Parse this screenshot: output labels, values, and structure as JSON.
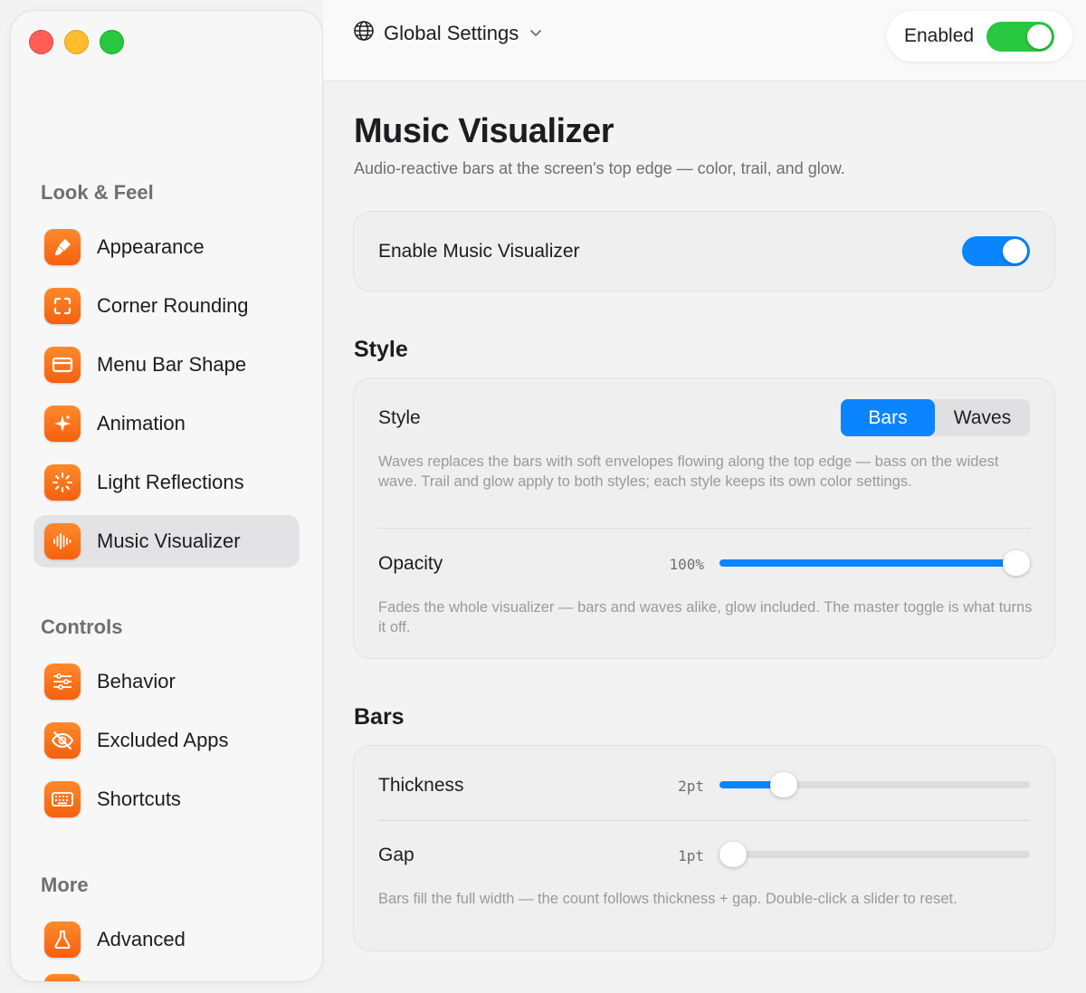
{
  "sidebar": {
    "sections": [
      {
        "title": "Look & Feel"
      },
      {
        "title": "Controls"
      },
      {
        "title": "More"
      }
    ],
    "items": [
      {
        "label": "Appearance",
        "icon": "paintbrush-icon"
      },
      {
        "label": "Corner Rounding",
        "icon": "corners-icon"
      },
      {
        "label": "Menu Bar Shape",
        "icon": "window-icon"
      },
      {
        "label": "Animation",
        "icon": "sparkle-icon"
      },
      {
        "label": "Light Reflections",
        "icon": "sun-rays-icon"
      },
      {
        "label": "Music Visualizer",
        "icon": "waveform-icon",
        "selected": true
      },
      {
        "label": "Behavior",
        "icon": "sliders-icon"
      },
      {
        "label": "Excluded Apps",
        "icon": "eye-slash-icon"
      },
      {
        "label": "Shortcuts",
        "icon": "keyboard-icon"
      },
      {
        "label": "Advanced",
        "icon": "flask-icon"
      }
    ]
  },
  "header": {
    "scope_label": "Global Settings",
    "enabled_label": "Enabled",
    "enabled": true
  },
  "page": {
    "title": "Music Visualizer",
    "subtitle": "Audio-reactive bars at the screen's top edge — color, trail, and glow."
  },
  "enable_card": {
    "label": "Enable Music Visualizer",
    "on": true
  },
  "style_section": {
    "title": "Style",
    "style_label": "Style",
    "options": [
      "Bars",
      "Waves"
    ],
    "selected": "Bars",
    "style_help": "Waves replaces the bars with soft envelopes flowing along the top edge — bass on the widest wave. Trail and glow apply to both styles; each style keeps its own color settings.",
    "opacity_label": "Opacity",
    "opacity_value": "100%",
    "opacity_fraction": 1.0,
    "opacity_help": "Fades the whole visualizer — bars and waves alike, glow included. The master toggle is what turns it off."
  },
  "bars_section": {
    "title": "Bars",
    "thickness_label": "Thickness",
    "thickness_value": "2pt",
    "thickness_fraction": 0.18,
    "gap_label": "Gap",
    "gap_value": "1pt",
    "gap_fraction": 0.0,
    "help": "Bars fill the full width — the count follows thickness + gap. Double-click a slider to reset."
  },
  "colors": {
    "accent": "#0a84ff",
    "icon_orange": "#f5600e",
    "toggle_green": "#28c840"
  }
}
